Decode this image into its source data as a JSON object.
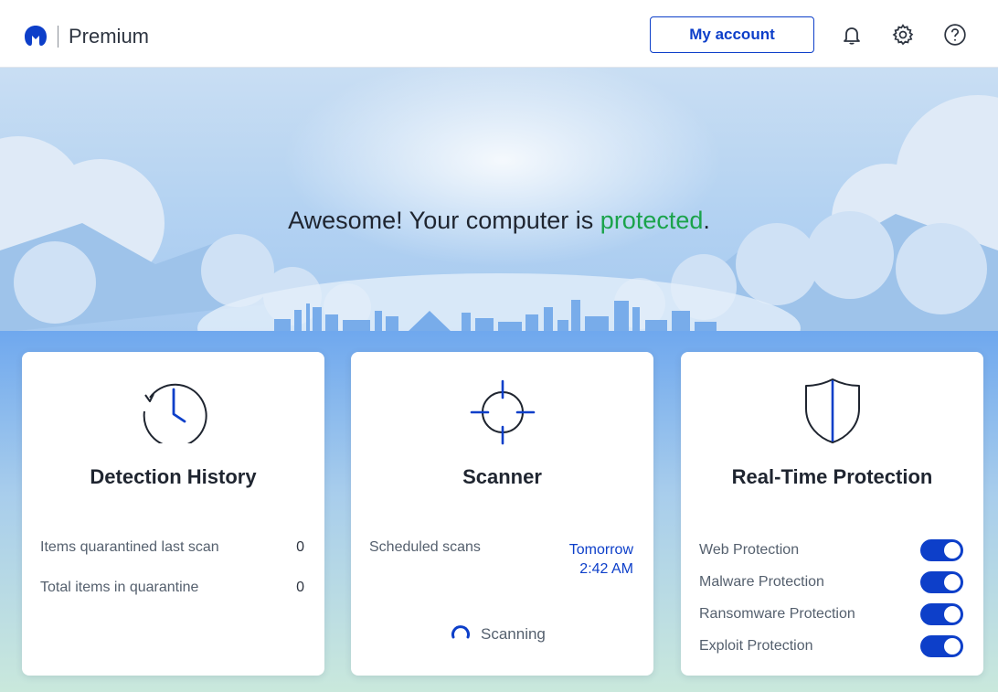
{
  "app": {
    "brand_name": "Premium"
  },
  "header": {
    "account_label": "My account",
    "icons": [
      "bell-icon",
      "gear-icon",
      "help-icon"
    ]
  },
  "hero": {
    "title_prefix": "Awesome! Your computer is ",
    "title_status": "protected",
    "title_suffix": ".",
    "status_color": "#1aa34a"
  },
  "cards": {
    "detection": {
      "icon": "clock-history-icon",
      "title": "Detection History",
      "rows": [
        {
          "label": "Items quarantined last scan",
          "value": "0"
        },
        {
          "label": "Total items in quarantine",
          "value": "0"
        }
      ]
    },
    "scanner": {
      "icon": "crosshair-icon",
      "title": "Scanner",
      "scheduled_label": "Scheduled scans",
      "scheduled_day": "Tomorrow",
      "scheduled_time": "2:42 AM",
      "status_label": "Scanning"
    },
    "protection": {
      "icon": "shield-icon",
      "title": "Real-Time Protection",
      "items": [
        {
          "label": "Web Protection",
          "enabled": true
        },
        {
          "label": "Malware Protection",
          "enabled": true
        },
        {
          "label": "Ransomware Protection",
          "enabled": true
        },
        {
          "label": "Exploit Protection",
          "enabled": true
        }
      ]
    }
  },
  "colors": {
    "accent_blue": "#0d3fc9",
    "status_green": "#1aa34a"
  }
}
